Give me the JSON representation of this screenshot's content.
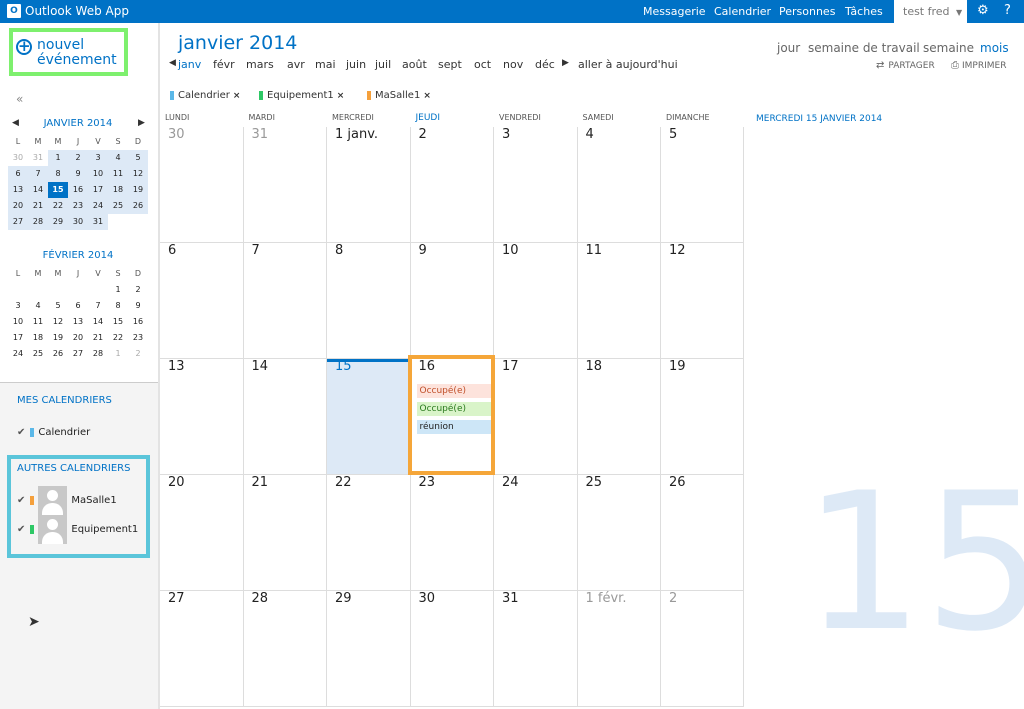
{
  "topbar": {
    "app_name": "Outlook Web App",
    "nav": [
      "Messagerie",
      "Calendrier",
      "Personnes",
      "Tâches"
    ],
    "active": "Calendrier",
    "user": "test fred"
  },
  "new_event": {
    "line1": "nouvel",
    "line2": "événement"
  },
  "collapse": "«",
  "mini_jan": {
    "title": "JANVIER 2014",
    "days": [
      "L",
      "M",
      "M",
      "J",
      "V",
      "S",
      "D"
    ],
    "dates": [
      [
        "30",
        "31",
        "1",
        "2",
        "3",
        "4",
        "5"
      ],
      [
        "6",
        "7",
        "8",
        "9",
        "10",
        "11",
        "12"
      ],
      [
        "13",
        "14",
        "15",
        "16",
        "17",
        "18",
        "19"
      ],
      [
        "20",
        "21",
        "22",
        "23",
        "24",
        "25",
        "26"
      ],
      [
        "27",
        "28",
        "29",
        "30",
        "31",
        "",
        ""
      ]
    ]
  },
  "mini_feb": {
    "title": "FÉVRIER 2014",
    "days": [
      "L",
      "M",
      "M",
      "J",
      "V",
      "S",
      "D"
    ],
    "dates": [
      [
        "",
        "",
        "",
        "",
        "",
        "1",
        "2"
      ],
      [
        "3",
        "4",
        "5",
        "6",
        "7",
        "8",
        "9"
      ],
      [
        "10",
        "11",
        "12",
        "13",
        "14",
        "15",
        "16"
      ],
      [
        "17",
        "18",
        "19",
        "20",
        "21",
        "22",
        "23"
      ],
      [
        "24",
        "25",
        "26",
        "27",
        "28",
        "1",
        "2"
      ]
    ]
  },
  "my_calendars": {
    "title": "MES CALENDRIERS",
    "items": [
      {
        "name": "Calendrier",
        "color": "#5bb8e8"
      }
    ]
  },
  "other_calendars": {
    "title": "AUTRES CALENDRIERS",
    "items": [
      {
        "name": "MaSalle1",
        "color": "#f5a03c"
      },
      {
        "name": "Equipement1",
        "color": "#2ec866"
      }
    ]
  },
  "header": {
    "month_title": "janvier 2014",
    "months": [
      "janv",
      "févr",
      "mars",
      "avr",
      "mai",
      "juin",
      "juil",
      "août",
      "sept",
      "oct",
      "nov",
      "déc"
    ],
    "selected_month": "janv",
    "today_link": "aller à aujourd'hui",
    "views": [
      "jour",
      "semaine de travail",
      "semaine",
      "mois"
    ],
    "selected_view": "mois",
    "share": "PARTAGER",
    "print": "IMPRIMER"
  },
  "filters": [
    {
      "name": "Calendrier",
      "color": "#5bb8e8"
    },
    {
      "name": "Equipement1",
      "color": "#2ec866"
    },
    {
      "name": "MaSalle1",
      "color": "#f5a03c"
    }
  ],
  "weekdays": [
    "LUNDI",
    "MARDI",
    "MERCREDI",
    "JEUDI",
    "VENDREDI",
    "SAMEDI",
    "DIMANCHE"
  ],
  "weeks": [
    [
      "30",
      "31",
      "1 janv.",
      "2",
      "3",
      "4",
      "5"
    ],
    [
      "6",
      "7",
      "8",
      "9",
      "10",
      "11",
      "12"
    ],
    [
      "13",
      "14",
      "15",
      "16",
      "17",
      "18",
      "19"
    ],
    [
      "20",
      "21",
      "22",
      "23",
      "24",
      "25",
      "26"
    ],
    [
      "27",
      "28",
      "29",
      "30",
      "31",
      "1 févr.",
      "2"
    ]
  ],
  "events_16": [
    {
      "text": "Occupé(e)",
      "bg": "#fde3dc",
      "color": "#c0502a"
    },
    {
      "text": "Occupé(e)",
      "bg": "#d9f4c9",
      "color": "#2a7a1e"
    },
    {
      "text": "réunion",
      "bg": "#cde6f7",
      "color": "#222"
    }
  ],
  "right_pane": {
    "title": "MERCREDI 15 JANVIER 2014",
    "big_day": "15"
  }
}
